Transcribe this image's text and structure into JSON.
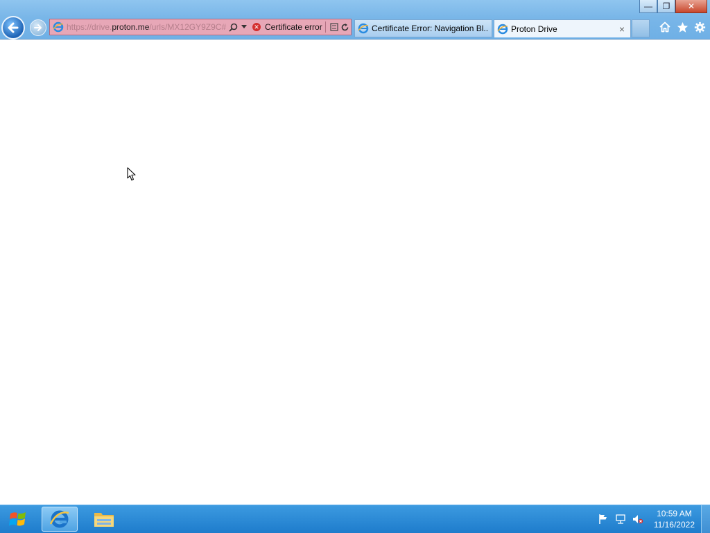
{
  "window": {
    "caption_buttons": {
      "minimize": "—",
      "restore": "❐",
      "close": "✕"
    }
  },
  "address_bar": {
    "url_prefix": "https://drive.",
    "url_domain": "proton.me",
    "url_suffix": "/urls/MX12GY9Z9C#",
    "security_status": "Certificate error",
    "accent_color": "#e7a7b7"
  },
  "tabs": [
    {
      "label": "Certificate Error: Navigation Bl...",
      "active": false
    },
    {
      "label": "Proton Drive",
      "active": true,
      "close": "×"
    }
  ],
  "toolbar_icons": [
    "home-icon",
    "favorites-star-icon",
    "tools-gear-icon"
  ],
  "taskbar": {
    "pinned": [
      "internet-explorer",
      "file-explorer"
    ],
    "clock": {
      "time": "10:59 AM",
      "date": "11/16/2022"
    }
  }
}
